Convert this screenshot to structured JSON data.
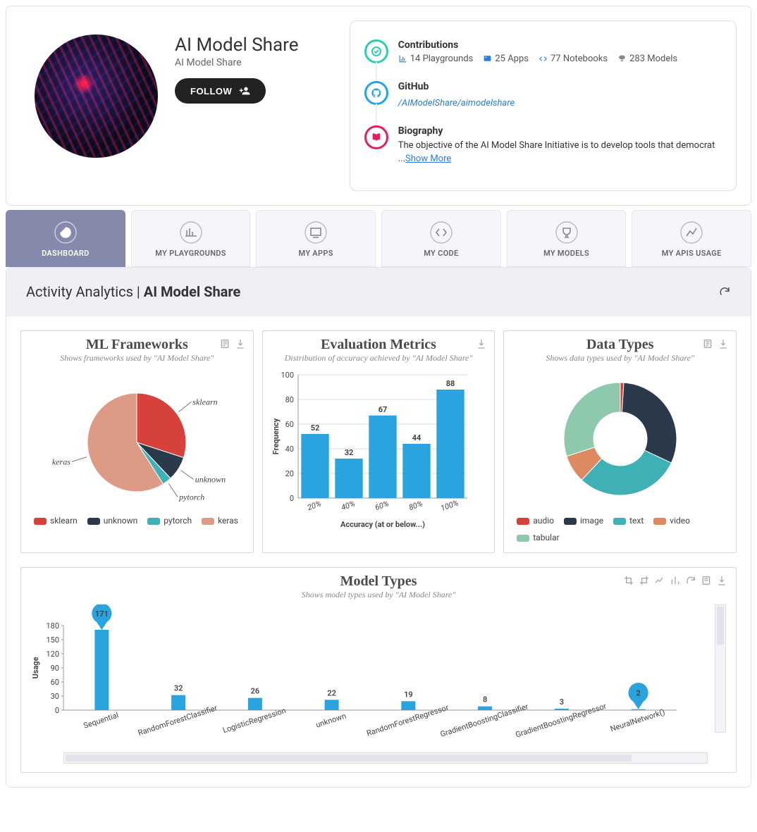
{
  "profile": {
    "name": "AI Model Share",
    "subtitle": "AI Model Share",
    "follow_label": "FOLLOW"
  },
  "contributions": {
    "title": "Contributions",
    "items": [
      {
        "label": "14 Playgrounds"
      },
      {
        "label": "25 Apps"
      },
      {
        "label": "77 Notebooks"
      },
      {
        "label": "283 Models"
      }
    ]
  },
  "github": {
    "title": "GitHub",
    "link": "/AIModelShare/aimodelshare"
  },
  "biography": {
    "title": "Biography",
    "text": "The objective of the AI Model Share Initiative is to develop tools that democrat ...",
    "show_more": "Show More"
  },
  "tabs": [
    {
      "label": "DASHBOARD",
      "active": true
    },
    {
      "label": "MY PLAYGROUNDS",
      "active": false
    },
    {
      "label": "MY APPS",
      "active": false
    },
    {
      "label": "MY CODE",
      "active": false
    },
    {
      "label": "MY MODELS",
      "active": false
    },
    {
      "label": "MY APIS USAGE",
      "active": false
    }
  ],
  "analytics": {
    "title_prefix": "Activity Analytics | ",
    "title_bold": "AI Model Share"
  },
  "colors": {
    "sklearn": "#d7413b",
    "unknown": "#2b3a4a",
    "pytorch": "#3fb0b5",
    "keras": "#dd9a84",
    "audio": "#d7413b",
    "image": "#2b3a4a",
    "text": "#3fb0b5",
    "video": "#dd8a63",
    "tabular": "#8fc9ad",
    "bar_blue": "#2aa3df"
  },
  "chart_data": [
    {
      "id": "ml_frameworks",
      "type": "pie",
      "title": "ML Frameworks",
      "subtitle": "Shows frameworks used by \"AI Model Share\"",
      "series": [
        {
          "name": "sklearn",
          "value": 30,
          "color": "#d7413b"
        },
        {
          "name": "unknown",
          "value": 8,
          "color": "#2b3a4a"
        },
        {
          "name": "pytorch",
          "value": 3,
          "color": "#3fb0b5"
        },
        {
          "name": "keras",
          "value": 59,
          "color": "#dd9a84"
        }
      ],
      "legend": [
        "sklearn",
        "unknown",
        "pytorch",
        "keras"
      ]
    },
    {
      "id": "eval_metrics",
      "type": "bar",
      "title": "Evaluation Metrics",
      "subtitle": "Distribution of accuracy achieved by \"AI Model Share\"",
      "categories": [
        "20%",
        "40%",
        "60%",
        "80%",
        "100%"
      ],
      "values": [
        52,
        32,
        67,
        44,
        88
      ],
      "xlabel": "Accuracy (at or below...)",
      "ylabel": "Frequency",
      "ylim": [
        0,
        100
      ]
    },
    {
      "id": "data_types",
      "type": "pie",
      "title": "Data Types",
      "subtitle": "Shows data types used by \"AI Model Share\"",
      "donut": true,
      "series": [
        {
          "name": "audio",
          "value": 1,
          "color": "#d7413b"
        },
        {
          "name": "image",
          "value": 31,
          "color": "#2b3a4a"
        },
        {
          "name": "text",
          "value": 30,
          "color": "#3fb0b5"
        },
        {
          "name": "video",
          "value": 8,
          "color": "#dd8a63"
        },
        {
          "name": "tabular",
          "value": 30,
          "color": "#8fc9ad"
        }
      ],
      "legend": [
        "audio",
        "image",
        "text",
        "video",
        "tabular"
      ]
    },
    {
      "id": "model_types",
      "type": "bar",
      "title": "Model Types",
      "subtitle": "Shows model types used by \"AI Model Share\"",
      "categories": [
        "Sequential",
        "RandomForestClassifier",
        "LogisticRegression",
        "unknown",
        "RandomForestRegressor",
        "GradientBoostingClassifier",
        "GradientBoostingRegressor",
        "NeuralNetwork()"
      ],
      "values": [
        171,
        32,
        26,
        22,
        19,
        8,
        3,
        2
      ],
      "xlabel": "",
      "ylabel": "Usage",
      "ylim": [
        0,
        180
      ],
      "pin_indices": [
        0,
        7
      ]
    }
  ]
}
